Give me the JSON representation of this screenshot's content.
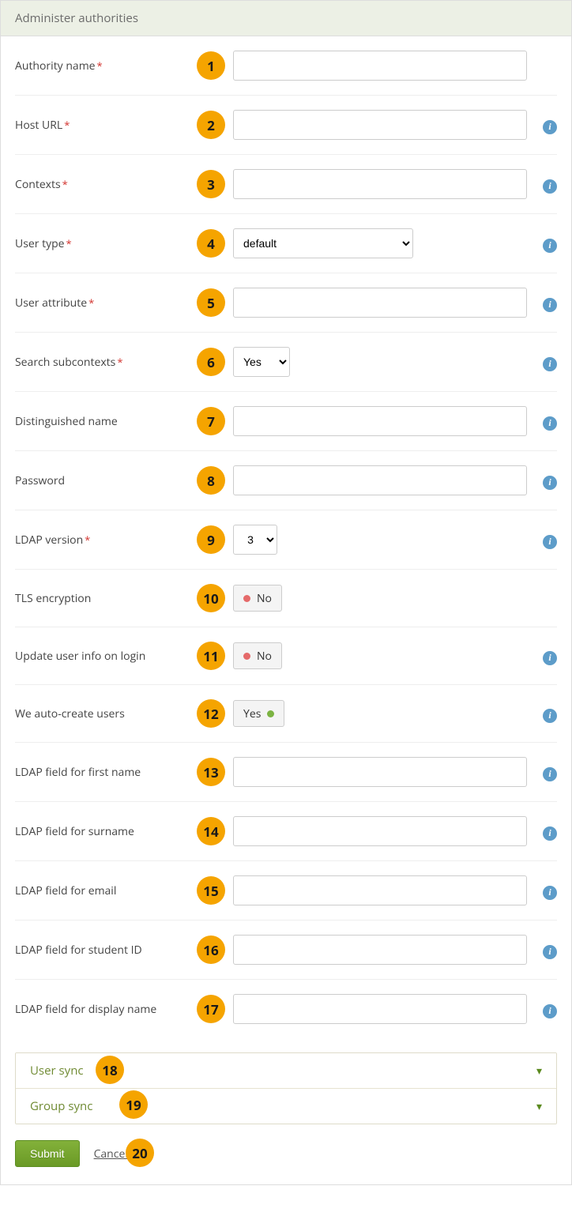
{
  "header": {
    "title": "Administer authorities"
  },
  "numbers": [
    "1",
    "2",
    "3",
    "4",
    "5",
    "6",
    "7",
    "8",
    "9",
    "10",
    "11",
    "12",
    "13",
    "14",
    "15",
    "16",
    "17",
    "18",
    "19",
    "20"
  ],
  "icons": {
    "info": "i",
    "chevron_down": "▾"
  },
  "fields": {
    "authority_name": {
      "label": "Authority name",
      "required": true,
      "value": "",
      "has_info": false
    },
    "host_url": {
      "label": "Host URL",
      "required": true,
      "value": "",
      "has_info": true
    },
    "contexts": {
      "label": "Contexts",
      "required": true,
      "value": "",
      "has_info": true
    },
    "user_type": {
      "label": "User type",
      "required": true,
      "selected": "default",
      "has_info": true
    },
    "user_attribute": {
      "label": "User attribute",
      "required": true,
      "value": "",
      "has_info": true
    },
    "search_sub": {
      "label": "Search subcontexts",
      "required": true,
      "selected": "Yes",
      "has_info": true
    },
    "dn": {
      "label": "Distinguished name",
      "required": false,
      "value": "",
      "has_info": true
    },
    "password": {
      "label": "Password",
      "required": false,
      "value": "",
      "has_info": true
    },
    "ldap_version": {
      "label": "LDAP version",
      "required": true,
      "selected": "3",
      "has_info": true
    },
    "tls": {
      "label": "TLS encryption",
      "required": false,
      "state": "no",
      "state_label": "No",
      "has_info": false
    },
    "update_login": {
      "label": "Update user info on login",
      "required": false,
      "state": "no",
      "state_label": "No",
      "has_info": true
    },
    "autocreate": {
      "label": "We auto-create users",
      "required": false,
      "state": "yes",
      "state_label": "Yes",
      "has_info": true
    },
    "firstname": {
      "label": "LDAP field for first name",
      "required": false,
      "value": "",
      "has_info": true
    },
    "surname": {
      "label": "LDAP field for surname",
      "required": false,
      "value": "",
      "has_info": true
    },
    "email": {
      "label": "LDAP field for email",
      "required": false,
      "value": "",
      "has_info": true
    },
    "studentid": {
      "label": "LDAP field for student ID",
      "required": false,
      "value": "",
      "has_info": true
    },
    "displayname": {
      "label": "LDAP field for display name",
      "required": false,
      "value": "",
      "has_info": true
    }
  },
  "accordion": {
    "user_sync": "User sync",
    "group_sync": "Group sync"
  },
  "actions": {
    "submit": "Submit",
    "cancel": "Cancel"
  }
}
